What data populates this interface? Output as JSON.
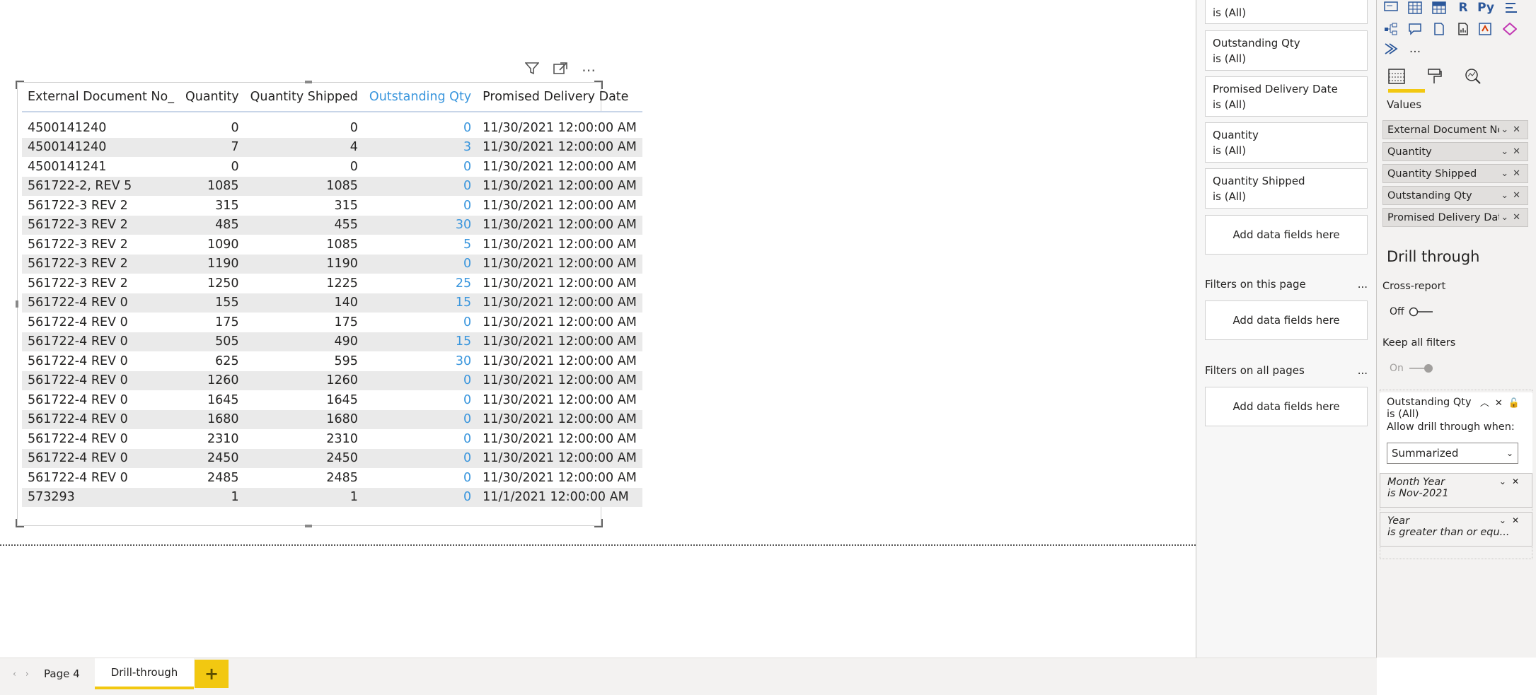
{
  "visual": {
    "columns": [
      "External Document No_",
      "Quantity",
      "Quantity Shipped",
      "Outstanding Qty",
      "Promised Delivery Date"
    ],
    "rows": [
      [
        "4500141240",
        "0",
        "0",
        "0",
        "11/30/2021 12:00:00 AM"
      ],
      [
        "4500141240",
        "7",
        "4",
        "3",
        "11/30/2021 12:00:00 AM"
      ],
      [
        "4500141241",
        "0",
        "0",
        "0",
        "11/30/2021 12:00:00 AM"
      ],
      [
        "561722-2, REV 5",
        "1085",
        "1085",
        "0",
        "11/30/2021 12:00:00 AM"
      ],
      [
        "561722-3 REV 2",
        "315",
        "315",
        "0",
        "11/30/2021 12:00:00 AM"
      ],
      [
        "561722-3 REV 2",
        "485",
        "455",
        "30",
        "11/30/2021 12:00:00 AM"
      ],
      [
        "561722-3 REV 2",
        "1090",
        "1085",
        "5",
        "11/30/2021 12:00:00 AM"
      ],
      [
        "561722-3 REV 2",
        "1190",
        "1190",
        "0",
        "11/30/2021 12:00:00 AM"
      ],
      [
        "561722-3 REV 2",
        "1250",
        "1225",
        "25",
        "11/30/2021 12:00:00 AM"
      ],
      [
        "561722-4 REV 0",
        "155",
        "140",
        "15",
        "11/30/2021 12:00:00 AM"
      ],
      [
        "561722-4 REV 0",
        "175",
        "175",
        "0",
        "11/30/2021 12:00:00 AM"
      ],
      [
        "561722-4 REV 0",
        "505",
        "490",
        "15",
        "11/30/2021 12:00:00 AM"
      ],
      [
        "561722-4 REV 0",
        "625",
        "595",
        "30",
        "11/30/2021 12:00:00 AM"
      ],
      [
        "561722-4 REV 0",
        "1260",
        "1260",
        "0",
        "11/30/2021 12:00:00 AM"
      ],
      [
        "561722-4 REV 0",
        "1645",
        "1645",
        "0",
        "11/30/2021 12:00:00 AM"
      ],
      [
        "561722-4 REV 0",
        "1680",
        "1680",
        "0",
        "11/30/2021 12:00:00 AM"
      ],
      [
        "561722-4 REV 0",
        "2310",
        "2310",
        "0",
        "11/30/2021 12:00:00 AM"
      ],
      [
        "561722-4 REV 0",
        "2450",
        "2450",
        "0",
        "11/30/2021 12:00:00 AM"
      ],
      [
        "561722-4 REV 0",
        "2485",
        "2485",
        "0",
        "11/30/2021 12:00:00 AM"
      ],
      [
        "573293",
        "1",
        "1",
        "0",
        "11/1/2021 12:00:00 AM"
      ]
    ],
    "header_icons": [
      "filter-icon",
      "focus-mode-icon",
      "more-options-icon"
    ],
    "highlight_color": "#3a96dd"
  },
  "filters": {
    "visual_cards": [
      {
        "title": "",
        "state": "is (All)"
      },
      {
        "title": "Outstanding Qty",
        "state": "is (All)"
      },
      {
        "title": "Promised Delivery Date",
        "state": "is (All)"
      },
      {
        "title": "Quantity",
        "state": "is (All)"
      },
      {
        "title": "Quantity Shipped",
        "state": "is (All)"
      }
    ],
    "add_label": "Add data fields here",
    "page_section": "Filters on this page",
    "all_section": "Filters on all pages",
    "more": "..."
  },
  "viz": {
    "values_label": "Values",
    "fields": [
      "External Document No_",
      "Quantity",
      "Quantity Shipped",
      "Outstanding Qty",
      "Promised Delivery Date"
    ],
    "drill_title": "Drill through",
    "cross_report": "Cross-report",
    "cross_state": "Off",
    "keep_filters": "Keep all filters",
    "keep_state": "On",
    "dt_card": {
      "title": "Outstanding Qty",
      "state": "is (All)",
      "allow": "Allow drill through when:",
      "select": "Summarized"
    },
    "dt_filters": [
      {
        "title": "Month Year",
        "state": "is Nov-2021"
      },
      {
        "title": "Year",
        "state": "is greater than or equ..."
      }
    ],
    "icon_row_text": {
      "r": "R",
      "py": "Py",
      "more": "..."
    }
  },
  "tabs": {
    "pages": [
      "Page 4",
      "Drill-through"
    ],
    "active": "Drill-through",
    "add": "+"
  },
  "colors": {
    "accent": "#f2c811"
  }
}
